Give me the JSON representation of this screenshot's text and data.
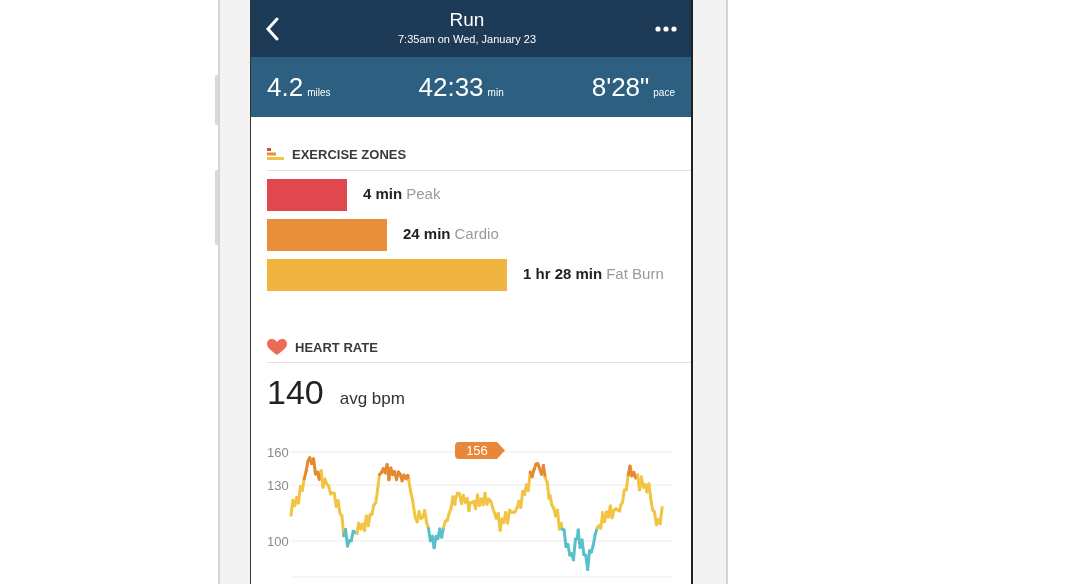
{
  "header": {
    "title": "Run",
    "subtitle": "7:35am on Wed, January 23"
  },
  "stats": [
    {
      "value": "4.2",
      "unit": "miles"
    },
    {
      "value": "42:33",
      "unit": "min"
    },
    {
      "value": "8'28\"",
      "unit": "pace"
    }
  ],
  "exercise_zones": {
    "title": "EXERCISE ZONES",
    "zones": [
      {
        "duration": "4 min",
        "name": "Peak",
        "color": "#e0474f"
      },
      {
        "duration": "24 min",
        "name": "Cardio",
        "color": "#e98e3b"
      },
      {
        "duration": "1 hr 28 min",
        "name": "Fat Burn",
        "color": "#f0b441"
      }
    ]
  },
  "heart_rate": {
    "title": "HEART RATE",
    "average": "140",
    "average_unit": "avg bpm",
    "y_ticks": [
      "160",
      "130",
      "100"
    ],
    "peak_badge": "156"
  }
}
